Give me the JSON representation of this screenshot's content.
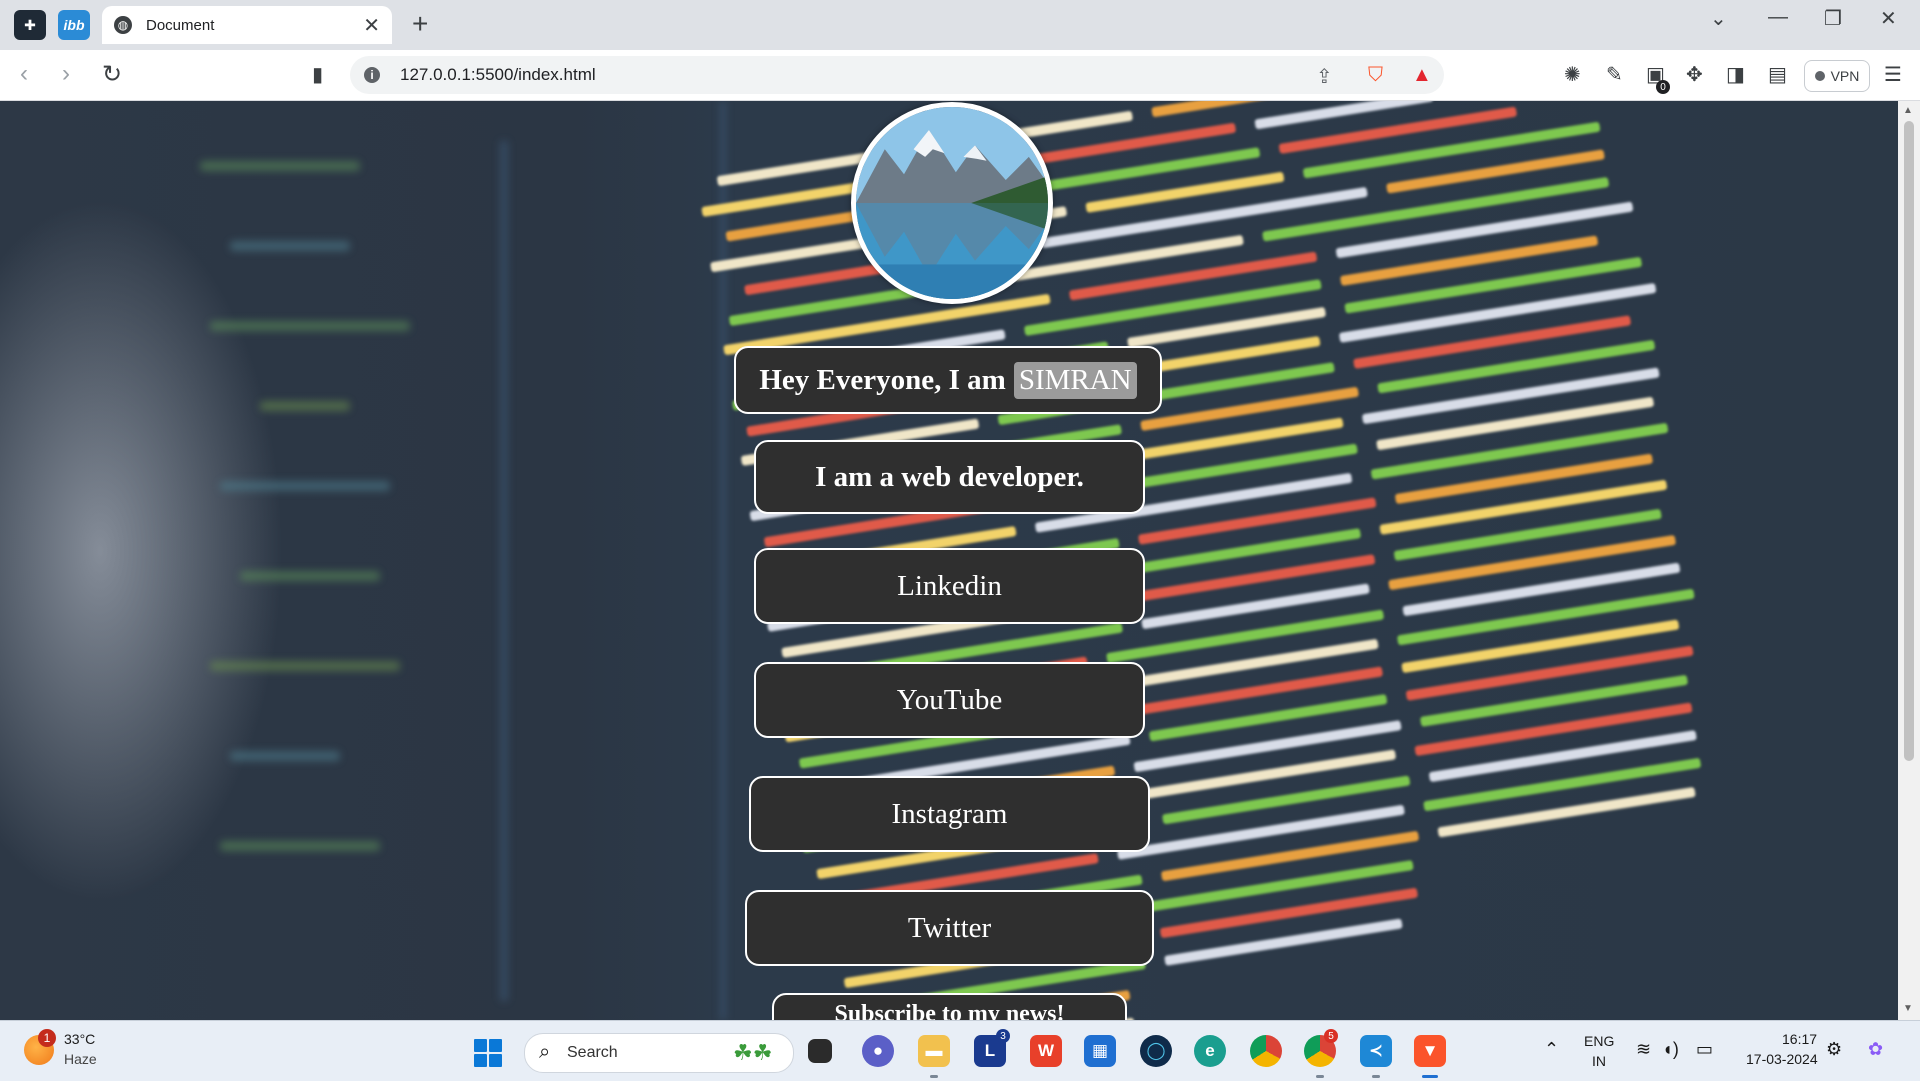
{
  "browser": {
    "tab_title": "Document",
    "tab_close": "✕",
    "new_tab": "+",
    "url": "127.0.0.1:5500/index.html",
    "vpn_label": "VPN",
    "window_controls": [
      "⌄",
      "—",
      "❐",
      "✕"
    ],
    "nav": {
      "back": "‹",
      "forward": "›",
      "reload": "↻"
    }
  },
  "page": {
    "intro_prefix": "Hey Everyone, I am",
    "name": "SIMRAN",
    "role": "I am a web developer.",
    "links": [
      {
        "label": "Linkedin"
      },
      {
        "label": "YouTube"
      },
      {
        "label": "Instagram"
      },
      {
        "label": "Twitter"
      },
      {
        "label": "Subscribe to my news!"
      }
    ]
  },
  "taskbar": {
    "weather_temp": "33°C",
    "weather_desc": "Haze",
    "weather_alert_count": "1",
    "search_label": "Search",
    "language_primary": "ENG",
    "language_secondary": "IN",
    "time": "16:17",
    "date": "17-03-2024",
    "lens_badge": "3",
    "chrome_badge": "5",
    "extension_badge": "0"
  }
}
